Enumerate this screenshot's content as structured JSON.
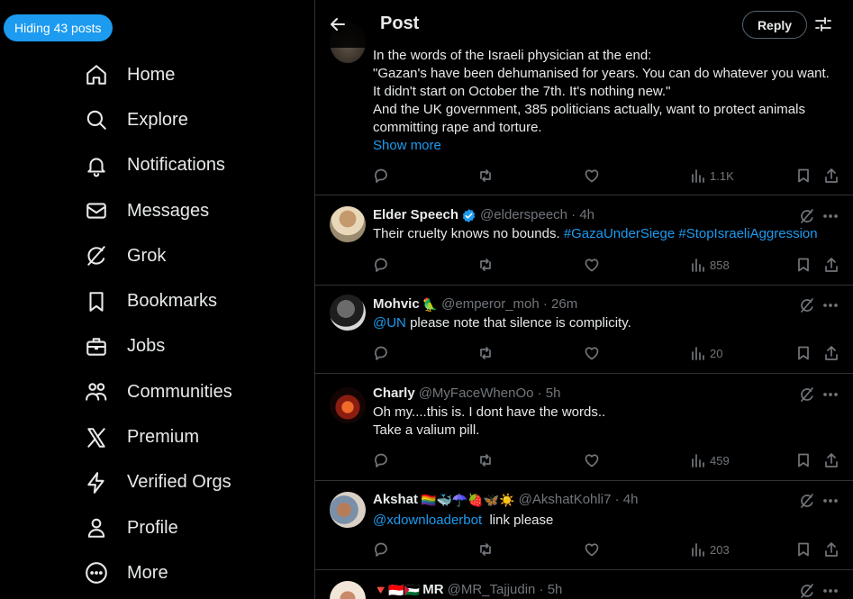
{
  "hiding_pill": "Hiding 43 posts",
  "nav": [
    {
      "label": "Home",
      "icon": "home-icon"
    },
    {
      "label": "Explore",
      "icon": "search-icon"
    },
    {
      "label": "Notifications",
      "icon": "bell-icon"
    },
    {
      "label": "Messages",
      "icon": "envelope-icon"
    },
    {
      "label": "Grok",
      "icon": "grok-icon"
    },
    {
      "label": "Bookmarks",
      "icon": "bookmark-icon"
    },
    {
      "label": "Jobs",
      "icon": "briefcase-icon"
    },
    {
      "label": "Communities",
      "icon": "people-icon"
    },
    {
      "label": "Premium",
      "icon": "x-logo-icon"
    },
    {
      "label": "Verified Orgs",
      "icon": "lightning-icon"
    },
    {
      "label": "Profile",
      "icon": "person-icon"
    },
    {
      "label": "More",
      "icon": "more-circle-icon"
    }
  ],
  "header": {
    "title": "Post",
    "reply_button": "Reply"
  },
  "main_post": {
    "lines": [
      "In the words of the Israeli physician at the end:",
      "\"Gazan's have been dehumanised for years. You can do whatever you want.",
      "It didn't start on October the 7th. It's nothing new.\"",
      "And the UK government, 385 politicians actually, want to protect animals",
      "committing rape and torture."
    ],
    "show_more": "Show more",
    "views": "1.1K"
  },
  "replies": [
    {
      "name": "Elder Speech",
      "verified": true,
      "emojis": "",
      "meta": "@elderspeech · 4h",
      "text_plain": "Their cruelty knows no bounds. ",
      "text_link": "#GazaUnderSiege #StopIsraeliAggression",
      "text_after": "",
      "second_line": "",
      "views": "858"
    },
    {
      "name": "Mohvic",
      "verified": false,
      "emojis": "🦜",
      "meta": "@emperor_moh · 26m",
      "text_plain": "",
      "text_link": "@UN",
      "text_after": " please note that silence is complicity.",
      "second_line": "",
      "views": "20"
    },
    {
      "name": "Charly",
      "verified": false,
      "emojis": "",
      "meta": "@MyFaceWhenOo · 5h",
      "text_plain": "Oh my....this is. I dont have the words..",
      "text_link": "",
      "text_after": "",
      "second_line": "Take a valium pill.",
      "views": "459"
    },
    {
      "name": "Akshat",
      "verified": false,
      "emojis": "🏳️‍🌈🐳☂️🍓🦋☀️",
      "meta": "@AkshatKohli7 · 4h",
      "text_plain": "",
      "text_link": "@xdownloaderbot",
      "text_after": "  link please",
      "second_line": "",
      "views": "203"
    },
    {
      "name": "MR",
      "verified": false,
      "emojis": "🔻🇮🇩🇵🇸",
      "meta": "@MR_Tajjudin · 5h",
      "text_plain": "",
      "text_link": "",
      "text_after": "",
      "second_line": "",
      "views": ""
    }
  ],
  "colors": {
    "accent": "#1d9bf0",
    "background": "#000000",
    "text": "#e7e9ea",
    "muted": "#71767b",
    "border": "#2f3336"
  }
}
